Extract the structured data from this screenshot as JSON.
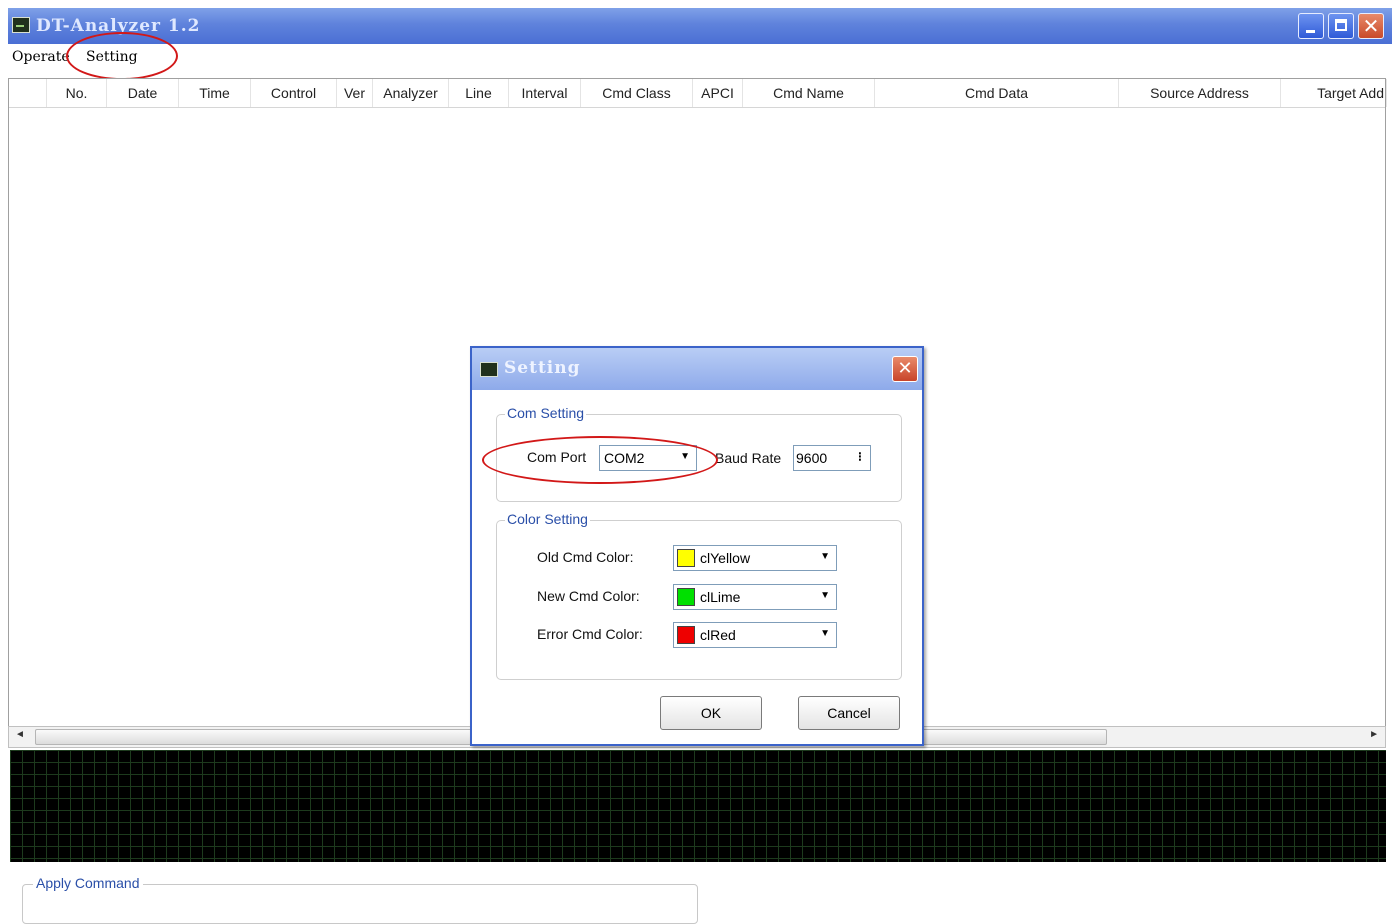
{
  "window": {
    "title": "DT-Analyzer 1.2",
    "minimize_glyph": "",
    "maximize_glyph": "",
    "close_glyph": "✕"
  },
  "menu": {
    "operate_label": "Operate",
    "setting_label": "Setting"
  },
  "table": {
    "columns": [
      "No.",
      "Date",
      "Time",
      "Control",
      "Ver",
      "Analyzer",
      "Line",
      "Interval",
      "Cmd Class",
      "APCI",
      "Cmd Name",
      "Cmd Data",
      "Source Address",
      "Target Add"
    ]
  },
  "scrollbar": {
    "left_arrow": "◄",
    "right_arrow": "►"
  },
  "apply": {
    "legend": "Apply Command"
  },
  "dialog": {
    "title": "Setting",
    "close_glyph": "✕",
    "com_group": "Com Setting",
    "com_port_label": "Com Port",
    "com_port_value": "COM2",
    "baud_rate_label": "Baud Rate",
    "baud_rate_value": "9600",
    "color_group": "Color Setting",
    "old_cmd_label": "Old Cmd Color:",
    "old_cmd_value": "clYellow",
    "old_cmd_color": "#ffff00",
    "new_cmd_label": "New Cmd Color:",
    "new_cmd_value": "clLime",
    "new_cmd_color": "#00e000",
    "error_cmd_label": "Error Cmd Color:",
    "error_cmd_value": "clRed",
    "error_cmd_color": "#ee0000",
    "ok_label": "OK",
    "cancel_label": "Cancel",
    "dropdown_glyph": "▼",
    "spin_glyph": "⁝"
  },
  "annotation_color": "#d21818"
}
